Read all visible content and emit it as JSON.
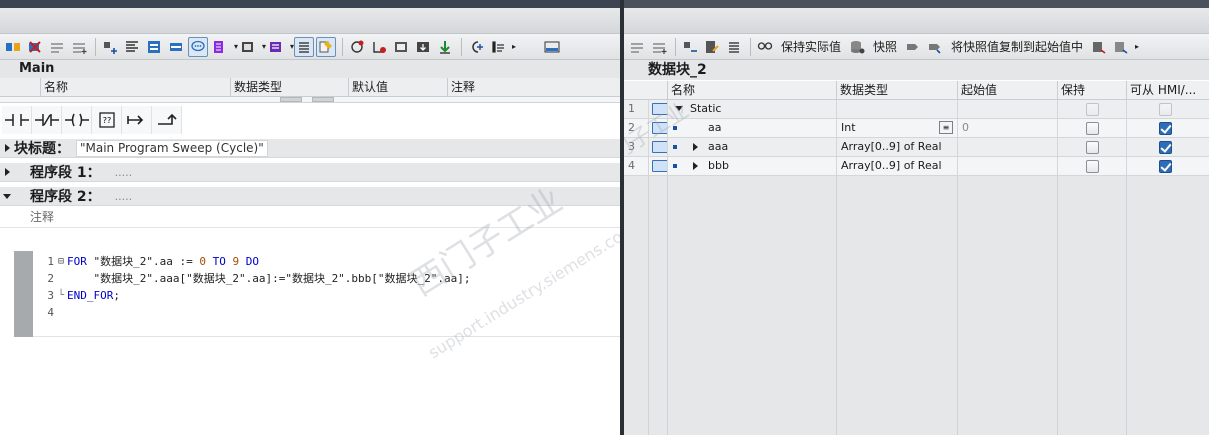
{
  "left": {
    "block_name": "Main",
    "interface_columns": [
      "名称",
      "数据类型",
      "默认值",
      "注释"
    ],
    "block_title_label": "块标题：",
    "block_title_value": "\"Main Program Sweep (Cycle)\"",
    "networks": [
      {
        "label": "程序段 1：",
        "dots": "....."
      },
      {
        "label": "程序段 2：",
        "dots": "....."
      }
    ],
    "comment_placeholder": "注释",
    "code": {
      "line_numbers": [
        "1",
        "2",
        "3",
        "4"
      ],
      "line1": {
        "kw_for": "FOR",
        "mid": " \"数据块_2\".aa := ",
        "n0": "0",
        "kw_to": " TO ",
        "n9": "9",
        "kw_do": " DO"
      },
      "line2": {
        "text": "    \"数据块_2\".aaa[\"数据块_2\".aa]:=\"数据块_2\".bbb[\"数据块_2\".aa];"
      },
      "line3": {
        "kw_end": "END_FOR",
        "tail": ";"
      }
    }
  },
  "right": {
    "toolbar": {
      "keep_actual_label": "保持实际值",
      "snapshot_label": "快照",
      "copy_snapshot_label": "将快照值复制到起始值中"
    },
    "db_name": "数据块_2",
    "columns": [
      "名称",
      "数据类型",
      "起始值",
      "保持",
      "可从 HMI/..."
    ],
    "rows": [
      {
        "num": "1",
        "name": "Static",
        "type": "",
        "start": "",
        "retain": false,
        "hmi": false,
        "expander": "down"
      },
      {
        "num": "2",
        "name": "aa",
        "type": "Int",
        "start": "0",
        "retain": false,
        "hmi": true,
        "expander": "none"
      },
      {
        "num": "3",
        "name": "aaa",
        "type": "Array[0..9] of Real",
        "start": "",
        "retain": false,
        "hmi": true,
        "expander": "right"
      },
      {
        "num": "4",
        "name": "bbb",
        "type": "Array[0..9] of Real",
        "start": "",
        "retain": false,
        "hmi": true,
        "expander": "right"
      }
    ]
  },
  "watermark": {
    "cn": "西门子工业",
    "url": "support.industry.siemens.com/cs"
  },
  "colors": {
    "accent": "#2f6db7",
    "header_bg": "#e4e6e8",
    "gutter": "#a7aaad"
  }
}
